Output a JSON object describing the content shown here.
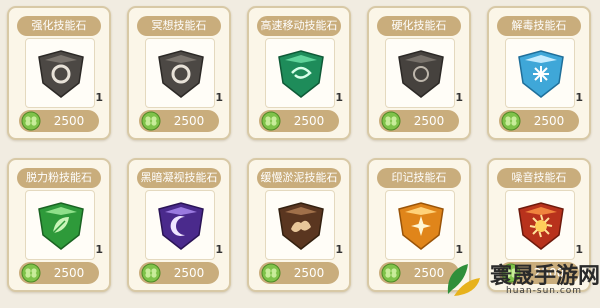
{
  "items": [
    {
      "name": "强化技能石",
      "quantity": "1",
      "price": "2500",
      "gem": "ring-grey"
    },
    {
      "name": "冥想技能石",
      "quantity": "1",
      "price": "2500",
      "gem": "ring-grey"
    },
    {
      "name": "高速移动技能石",
      "quantity": "1",
      "price": "2500",
      "gem": "green-swirl"
    },
    {
      "name": "硬化技能石",
      "quantity": "1",
      "price": "2500",
      "gem": "grey-plain"
    },
    {
      "name": "解毒技能石",
      "quantity": "1",
      "price": "2500",
      "gem": "ice-blue"
    },
    {
      "name": "脱力粉技能石",
      "quantity": "1",
      "price": "2500",
      "gem": "green-leaf"
    },
    {
      "name": "黑暗凝视技能石",
      "quantity": "1",
      "price": "2500",
      "gem": "purple-moon"
    },
    {
      "name": "缓慢淤泥技能石",
      "quantity": "1",
      "price": "2500",
      "gem": "brown-mud"
    },
    {
      "name": "印记技能石",
      "quantity": "1",
      "price": "2500",
      "gem": "orange-sparkle"
    },
    {
      "name": "噪音技能石",
      "quantity": "1",
      "price": "2500",
      "gem": "red-burst"
    }
  ],
  "watermark": {
    "title": "寰晟手游网",
    "url": "huan-sun.com"
  },
  "colors": {
    "accent": "#c9ad7c",
    "card_bg": "#fbf6e8",
    "coin": "#7fc24a"
  }
}
